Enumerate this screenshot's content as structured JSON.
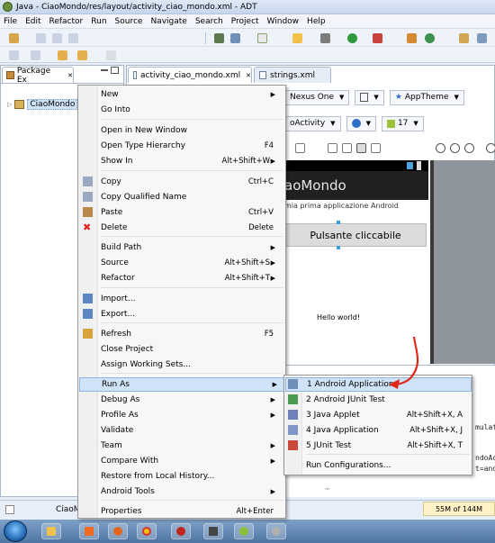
{
  "window": {
    "title": "Java - CiaoMondo/res/layout/activity_ciao_mondo.xml - ADT"
  },
  "menubar": [
    "File",
    "Edit",
    "Refactor",
    "Run",
    "Source",
    "Navigate",
    "Search",
    "Project",
    "Window",
    "Help"
  ],
  "package_explorer": {
    "tab_label": "Package Ex",
    "close": "✕",
    "project": "CiaoMondo",
    "bottom_label": "CiaoMo"
  },
  "editor": {
    "tabs": [
      {
        "label": "activity_ciao_mondo.xml",
        "close": "✕"
      },
      {
        "label": "strings.xml"
      }
    ],
    "toolbar": {
      "device": "Nexus One",
      "theme": "AppTheme",
      "activity": "oActivity",
      "api": "17"
    },
    "preview": {
      "app_title": "aoMondo",
      "subtitle": "mia prima applicazione Android",
      "button": "Pulsante cliccabile",
      "hello": "Hello world!"
    },
    "console_lines": [
      "mulat",
      "ndoAc",
      "t=and"
    ],
    "scroll_hint": "™"
  },
  "status": {
    "memory": "55M of 144M"
  },
  "context_menu": {
    "items": [
      {
        "label": "New",
        "submenu": true
      },
      {
        "label": "Go Into"
      },
      {
        "sep": true
      },
      {
        "label": "Open in New Window"
      },
      {
        "label": "Open Type Hierarchy",
        "accel": "F4"
      },
      {
        "label": "Show In",
        "accel": "Alt+Shift+W",
        "submenu": true
      },
      {
        "sep": true
      },
      {
        "label": "Copy",
        "accel": "Ctrl+C"
      },
      {
        "label": "Copy Qualified Name"
      },
      {
        "label": "Paste",
        "accel": "Ctrl+V"
      },
      {
        "label": "Delete",
        "accel": "Delete"
      },
      {
        "sep": true
      },
      {
        "label": "Build Path",
        "submenu": true
      },
      {
        "label": "Source",
        "accel": "Alt+Shift+S",
        "submenu": true
      },
      {
        "label": "Refactor",
        "accel": "Alt+Shift+T",
        "submenu": true
      },
      {
        "sep": true
      },
      {
        "label": "Import..."
      },
      {
        "label": "Export..."
      },
      {
        "sep": true
      },
      {
        "label": "Refresh",
        "accel": "F5"
      },
      {
        "label": "Close Project"
      },
      {
        "label": "Assign Working Sets..."
      },
      {
        "sep": true
      },
      {
        "label": "Run As",
        "submenu": true,
        "highlighted": true
      },
      {
        "label": "Debug As",
        "submenu": true
      },
      {
        "label": "Profile As",
        "submenu": true
      },
      {
        "label": "Validate"
      },
      {
        "label": "Team",
        "submenu": true
      },
      {
        "label": "Compare With",
        "submenu": true
      },
      {
        "label": "Restore from Local History..."
      },
      {
        "label": "Android Tools",
        "submenu": true
      },
      {
        "sep": true
      },
      {
        "label": "Properties",
        "accel": "Alt+Enter"
      }
    ]
  },
  "run_as_submenu": {
    "items": [
      {
        "label": "1 Android Application",
        "highlighted": true
      },
      {
        "label": "2 Android JUnit Test"
      },
      {
        "label": "3 Java Applet",
        "accel": "Alt+Shift+X, A"
      },
      {
        "label": "4 Java Application",
        "accel": "Alt+Shift+X, J"
      },
      {
        "label": "5 JUnit Test",
        "accel": "Alt+Shift+X, T"
      },
      {
        "sep": true
      },
      {
        "label": "Run Configurations..."
      }
    ]
  },
  "colors": {
    "highlight": "#cfe2f7",
    "highlight_border": "#8fb6e2",
    "annotation_arrow": "#e0271b",
    "delete_icon": "#d22"
  }
}
